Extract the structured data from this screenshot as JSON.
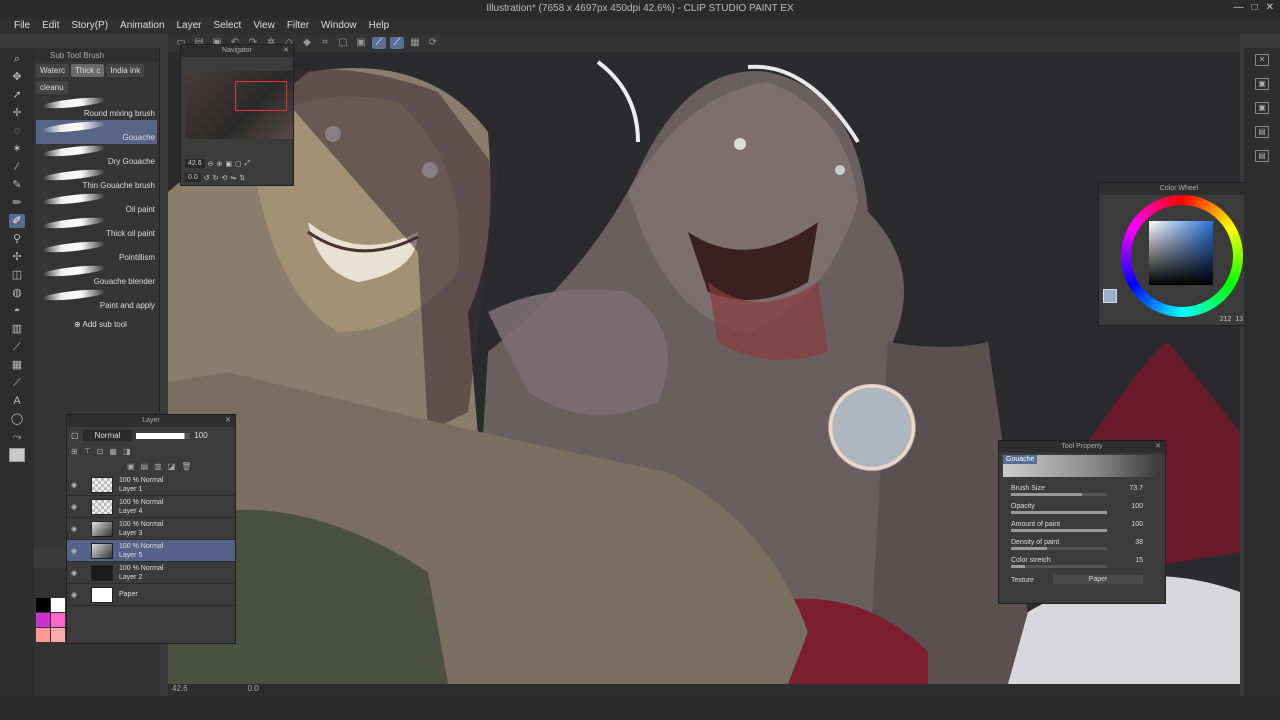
{
  "window": {
    "title": "Illustration* (7658 x 4697px 450dpi 42.6%) - CLIP STUDIO PAINT EX",
    "controls": [
      "—",
      "□",
      "✕"
    ]
  },
  "menu": [
    "File",
    "Edit",
    "Story(P)",
    "Animation",
    "Layer",
    "Select",
    "View",
    "Filter",
    "Window",
    "Help"
  ],
  "subtool": {
    "panel_title": "Sub Tool Brush",
    "tabs": [
      "Waterc",
      "Thick c",
      "India ink",
      "cleanu"
    ],
    "brushes": [
      {
        "name": "Round mixing brush",
        "selected": false
      },
      {
        "name": "Gouache",
        "selected": true
      },
      {
        "name": "Dry Gouache",
        "selected": false
      },
      {
        "name": "Thin Gouache brush",
        "selected": false
      },
      {
        "name": "Oil paint",
        "selected": false
      },
      {
        "name": "Thick oil paint",
        "selected": false
      },
      {
        "name": "Pointillism",
        "selected": false
      },
      {
        "name": "Gouache blender",
        "selected": false
      },
      {
        "name": "Paint and apply",
        "selected": false
      }
    ],
    "add_label": "Add sub tool"
  },
  "navigator": {
    "title": "Navigator",
    "zoom": "42.6",
    "rotation": "0.0"
  },
  "layers": {
    "title": "Layer",
    "blend_mode": "Normal",
    "opacity": "100",
    "rows": [
      {
        "line1": "100 % Normal",
        "line2": "Layer 1",
        "thumb": "checker",
        "selected": false
      },
      {
        "line1": "100 % Normal",
        "line2": "Layer 4",
        "thumb": "checker",
        "selected": false
      },
      {
        "line1": "100 % Normal",
        "line2": "Layer 3",
        "thumb": "ill",
        "selected": false
      },
      {
        "line1": "100 % Normal",
        "line2": "Layer 5",
        "thumb": "ill",
        "selected": true
      },
      {
        "line1": "100 % Normal",
        "line2": "Layer 2",
        "thumb": "dark",
        "selected": false
      },
      {
        "line1": "",
        "line2": "Paper",
        "thumb": "white",
        "selected": false
      }
    ]
  },
  "colorwheel": {
    "title": "Color Wheel",
    "h": "212",
    "s": "13",
    "v": "70"
  },
  "toolprop": {
    "title": "Tool Property",
    "brush": "Gouache",
    "props": [
      {
        "label": "Brush Size",
        "value": "73.7",
        "fill": 0.74
      },
      {
        "label": "Opacity",
        "value": "100",
        "fill": 1.0
      },
      {
        "label": "Amount of paint",
        "value": "100",
        "fill": 1.0
      },
      {
        "label": "Density of paint",
        "value": "38",
        "fill": 0.38
      },
      {
        "label": "Color stretch",
        "value": "15",
        "fill": 0.15
      }
    ],
    "texture_label": "Texture",
    "texture_value": "Paper"
  },
  "status": {
    "zoom": "42.6",
    "angle": "0.0"
  },
  "palette_colors": [
    "#000000",
    "#ffffff",
    "#000000",
    "#ffffff",
    "#ffff33",
    "#33ff33",
    "#33ccff",
    "#3366ff",
    "#cc33cc",
    "#ff66cc",
    "#ff99cc",
    "#ffaacc",
    "#ffbbaa",
    "#ffccaa",
    "#ffbb88",
    "#ffaa66",
    "#ff9999",
    "#ffaaaa",
    "#ffbbbb",
    "#ffcccc",
    "#ffd0b0",
    "#ffc8a0",
    "#f0b090",
    "#e0a080"
  ]
}
